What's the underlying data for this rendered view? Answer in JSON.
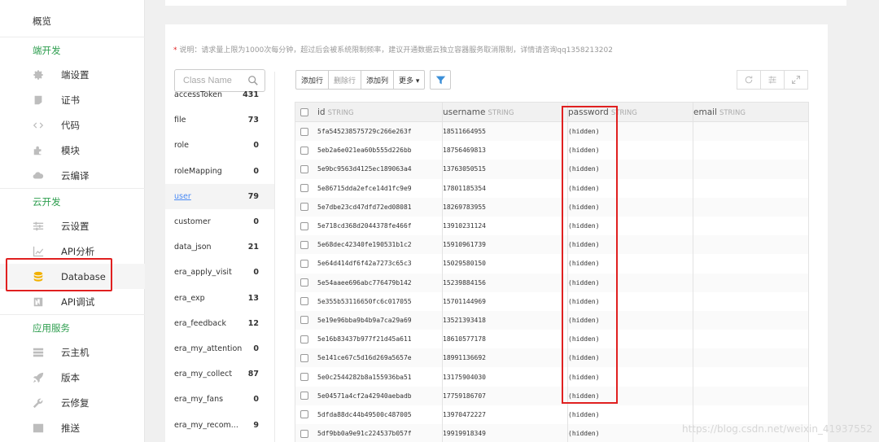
{
  "sidebar": {
    "overview": "概览",
    "sections": [
      {
        "title": "端开发",
        "items": [
          {
            "label": "端设置",
            "icon": "gear-icon"
          },
          {
            "label": "证书",
            "icon": "certificate-icon"
          },
          {
            "label": "代码",
            "icon": "code-icon"
          },
          {
            "label": "模块",
            "icon": "puzzle-icon"
          },
          {
            "label": "云编译",
            "icon": "cloud-icon"
          }
        ]
      },
      {
        "title": "云开发",
        "items": [
          {
            "label": "云设置",
            "icon": "sliders-icon"
          },
          {
            "label": "API分析",
            "icon": "chart-icon"
          },
          {
            "label": "Database",
            "icon": "database-icon",
            "active": true
          },
          {
            "label": "API调试",
            "icon": "debug-icon"
          }
        ]
      },
      {
        "title": "应用服务",
        "items": [
          {
            "label": "云主机",
            "icon": "server-icon"
          },
          {
            "label": "版本",
            "icon": "rocket-icon"
          },
          {
            "label": "云修复",
            "icon": "wrench-icon"
          },
          {
            "label": "推送",
            "icon": "message-icon"
          }
        ]
      }
    ]
  },
  "notice": {
    "star": "*",
    "text": "说明：请求量上限为1000次每分钟，超过后会被系统限制频率，建议开通数据云独立容器服务取消限制，详情请咨询qq1358213202"
  },
  "search": {
    "placeholder": "Class Name"
  },
  "classes": [
    {
      "name": "accessToken",
      "count": "431"
    },
    {
      "name": "file",
      "count": "73"
    },
    {
      "name": "role",
      "count": "0"
    },
    {
      "name": "roleMapping",
      "count": "0"
    },
    {
      "name": "user",
      "count": "79",
      "active": true
    },
    {
      "name": "customer",
      "count": "0"
    },
    {
      "name": "data_json",
      "count": "21"
    },
    {
      "name": "era_apply_visit",
      "count": "0"
    },
    {
      "name": "era_exp",
      "count": "13"
    },
    {
      "name": "era_feedback",
      "count": "12"
    },
    {
      "name": "era_my_attention",
      "count": "0"
    },
    {
      "name": "era_my_collect",
      "count": "87"
    },
    {
      "name": "era_my_fans",
      "count": "0"
    },
    {
      "name": "era_my_recom...",
      "count": "9"
    }
  ],
  "toolbar": {
    "add_row": "添加行",
    "delete_row": "删除行",
    "add_col": "添加列",
    "more": "更多 ▾"
  },
  "table": {
    "columns": [
      {
        "name": "id",
        "type": "STRING"
      },
      {
        "name": "username",
        "type": "STRING"
      },
      {
        "name": "password",
        "type": "STRING"
      },
      {
        "name": "email",
        "type": "STRING"
      }
    ],
    "rows": [
      [
        "5fa545238575729c266e263f",
        "18511664955",
        "(hidden)",
        ""
      ],
      [
        "5eb2a6e021ea60b555d226bb",
        "18756469813",
        "(hidden)",
        ""
      ],
      [
        "5e9bc9563d4125ec189063a4",
        "13763050515",
        "(hidden)",
        ""
      ],
      [
        "5e86715dda2efce14d1fc9e9",
        "17801185354",
        "(hidden)",
        ""
      ],
      [
        "5e7dbe23cd47dfd72ed08081",
        "18269783955",
        "(hidden)",
        ""
      ],
      [
        "5e718cd368d2044378fe466f",
        "13910231124",
        "(hidden)",
        ""
      ],
      [
        "5e68dec42340fe190531b1c2",
        "15910961739",
        "(hidden)",
        ""
      ],
      [
        "5e64d414df6f42a7273c65c3",
        "15029580150",
        "(hidden)",
        ""
      ],
      [
        "5e54aaee696abc776479b142",
        "15239884156",
        "(hidden)",
        ""
      ],
      [
        "5e355b53116650fc6c017055",
        "15701144969",
        "(hidden)",
        ""
      ],
      [
        "5e19e96bba9b4b9a7ca29a69",
        "13521393418",
        "(hidden)",
        ""
      ],
      [
        "5e16b83437b977f21d45a611",
        "18610577178",
        "(hidden)",
        ""
      ],
      [
        "5e141ce67c5d16d269a5657e",
        "18991136692",
        "(hidden)",
        ""
      ],
      [
        "5e0c2544282b8a155936ba51",
        "13175904030",
        "(hidden)",
        ""
      ],
      [
        "5e04571a4cf2a42940aebadb",
        "17759186707",
        "(hidden)",
        ""
      ],
      [
        "5dfda88dc44b49500c487005",
        "13970472227",
        "(hidden)",
        ""
      ],
      [
        "5df9bb0a9e91c224537b057f",
        "19919918349",
        "(hidden)",
        ""
      ]
    ]
  },
  "watermark": "https://blog.csdn.net/weixin_41937552",
  "colors": {
    "section_green": "#2e9e4f",
    "highlight_red": "#e02020",
    "active_link": "#4a8af4",
    "db_icon": "#f2b100"
  }
}
